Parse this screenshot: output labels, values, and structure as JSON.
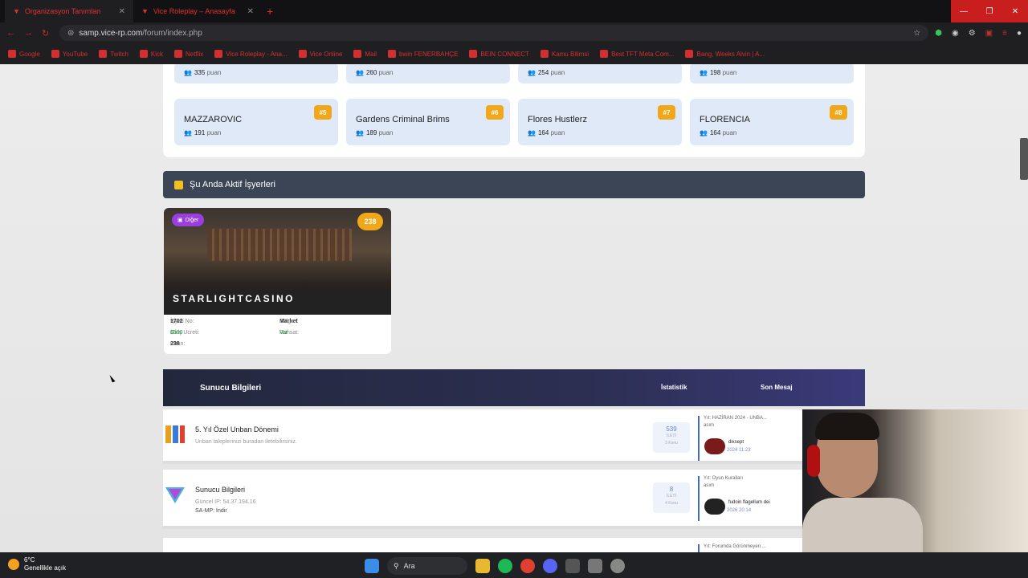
{
  "browser": {
    "tabs": [
      {
        "title": "Organizasyon Tanımlan",
        "active": true
      },
      {
        "title": "Vice Roleplay – Anasayfa",
        "active": false
      }
    ],
    "url_host": "samp.vice-rp.com",
    "url_path": "/forum/index.php",
    "bookmarks": [
      "Google",
      "YouTube",
      "Twitch",
      "Kick",
      "Netflix",
      "Vice Roleplay - Ana...",
      "Vice Online",
      "Mail",
      "bwin FENERBAHÇE",
      "BEIN CONNECT",
      "Kamu Bilimsi",
      "Best TFT Meta Com...",
      "Bang, Weeks Alvin | A..."
    ]
  },
  "clans": {
    "top_row_points": [
      "335",
      "260",
      "254",
      "198"
    ],
    "pts_suffix": "puan",
    "items": [
      {
        "name": "MAZZAROVIC",
        "points": "191",
        "rank": "#5"
      },
      {
        "name": "Gardens Criminal Brims",
        "points": "189",
        "rank": "#6"
      },
      {
        "name": "Flores Hustlerz",
        "points": "164",
        "rank": "#7"
      },
      {
        "name": "FLORENCIA",
        "points": "164",
        "rank": "#8"
      }
    ]
  },
  "businesses": {
    "header": "Şu Anda Aktif İşyerleri",
    "card": {
      "category": "Diğer",
      "points_badge": "238",
      "name": "STARLIGHTCASINO",
      "id_label": "İşyeri No:",
      "id": "1702",
      "fee_label": "Giriş Ücreti:",
      "fee": "$500",
      "score_label": "Puan:",
      "score": "238",
      "region_label": "Bölge:",
      "region": "Market",
      "license_label": "Ruhsat:",
      "license": "Var"
    }
  },
  "server": {
    "header_title": "Sunucu Bilgileri",
    "col_stats": "İstatistik",
    "col_last": "Son Mesaj",
    "rows": [
      {
        "title": "5. Yıl Özel Unban Dönemi",
        "sub": "Unban taleplerinizi buradan iletebilirsiniz.",
        "sub2": "",
        "count": "539",
        "count_label": "İLETİ",
        "topics": "3 Konu",
        "last_title": "Yıt: HAZİRAN 2024 - UNBA...",
        "last_meta": "asım",
        "last_user": "dixsept",
        "last_time": "2024 11:23"
      },
      {
        "title": "Sunucu Bilgileri",
        "sub": "Güncel IP: 54.37.194.16",
        "sub2": "SA-MP: İndir",
        "count": "8",
        "count_label": "İLETİ",
        "topics": "4 Konu",
        "last_title": "Yıt: Oyun Kuralları",
        "last_meta": "asım",
        "last_user": "fudoin flagellum dei",
        "last_time": "2026 20:14"
      }
    ],
    "partial_row": "Yıt: Forumda Görünmeyen ..."
  },
  "taskbar": {
    "temp": "6°C",
    "weather": "Genellikle açık",
    "search": "Ara"
  }
}
